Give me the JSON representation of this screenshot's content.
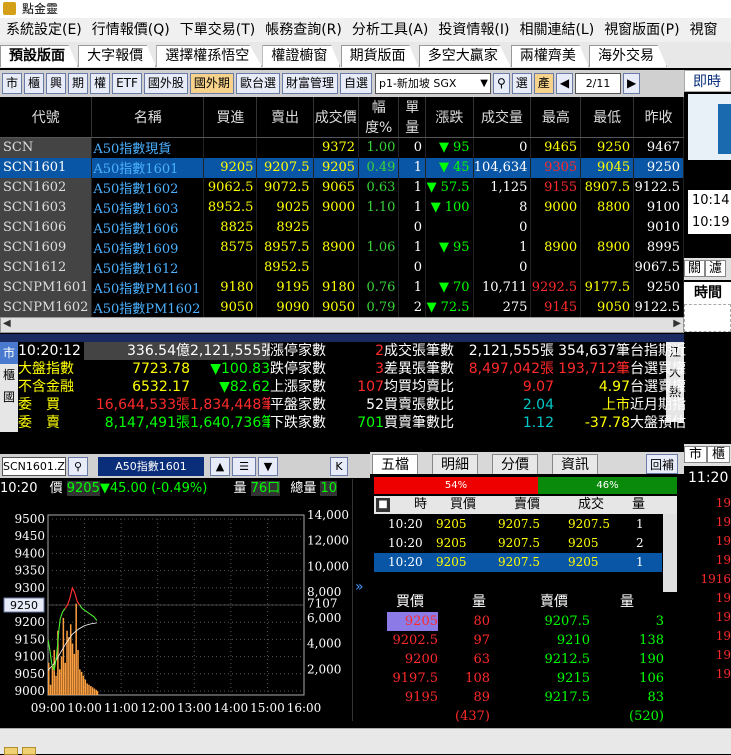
{
  "app_title": "點金靈",
  "menu": [
    "系統設定(E)",
    "行情報價(Q)",
    "下單交易(T)",
    "帳務查詢(R)",
    "分析工具(A)",
    "投資情報(I)",
    "相關連結(L)",
    "視窗版面(P)",
    "視窗"
  ],
  "page_tabs": [
    "預設版面",
    "大字報價",
    "選擇權孫悟空",
    "權證櫥窗",
    "期貨版面",
    "多空大贏家",
    "兩權齊美",
    "海外交易"
  ],
  "toolbar": {
    "buttons": [
      "市",
      "櫃",
      "興",
      "期",
      "權",
      "ETF",
      "國外股",
      "國外期",
      "歐台選",
      "財富管理",
      "自選"
    ],
    "highlight_index": 7,
    "group_select": "p1-新加坡 SGX",
    "search_icon": "search-icon",
    "select_btn": "選",
    "prod_btn": "產",
    "page_indicator": "2/11"
  },
  "right_panel": {
    "title": "即時新",
    "news_times": [
      "10:14",
      "10:19"
    ],
    "tabs": [
      "關",
      "濾"
    ],
    "time_header": "時間",
    "mkt_btns": [
      "市",
      "櫃"
    ],
    "time2": "11:20",
    "nums": [
      "19",
      "19",
      "19",
      "19",
      "1916",
      "19",
      "19",
      "19",
      "19",
      "19"
    ]
  },
  "quote_table": {
    "headers": [
      "代號",
      "名稱",
      "買進",
      "賣出",
      "成交價",
      "幅度%",
      "單量",
      "漲跌",
      "成交量",
      "最高",
      "最低",
      "昨收"
    ],
    "rows": [
      {
        "code": "SCN",
        "name": "A50指數現貨",
        "bid": "",
        "ask": "",
        "last": "9372",
        "pct": "1.00",
        "vol": "0",
        "dir": "up",
        "chg": "95",
        "qty": "0",
        "high": "9465",
        "low": "9250",
        "prev": "9467",
        "high_color": "y",
        "low_color": "y"
      },
      {
        "code": "SCN1601",
        "name": "A50指數1601",
        "bid": "9205",
        "ask": "9207.5",
        "last": "9205",
        "pct": "0.49",
        "vol": "1",
        "dir": "down",
        "chg": "45",
        "qty": "104,634",
        "high": "9305",
        "low": "9045",
        "prev": "9250",
        "high_color": "r",
        "low_color": "y",
        "selected": true
      },
      {
        "code": "SCN1602",
        "name": "A50指數1602",
        "bid": "9062.5",
        "ask": "9072.5",
        "last": "9065",
        "pct": "0.63",
        "vol": "1",
        "dir": "down",
        "chg": "57.5",
        "qty": "1,125",
        "high": "9155",
        "low": "8907.5",
        "prev": "9122.5",
        "high_color": "r",
        "low_color": "y"
      },
      {
        "code": "SCN1603",
        "name": "A50指數1603",
        "bid": "8952.5",
        "ask": "9025",
        "last": "9000",
        "pct": "1.10",
        "vol": "1",
        "dir": "down",
        "chg": "100",
        "qty": "8",
        "high": "9000",
        "low": "8800",
        "prev": "9100",
        "high_color": "y",
        "low_color": "y"
      },
      {
        "code": "SCN1606",
        "name": "A50指數1606",
        "bid": "8825",
        "ask": "8925",
        "last": "",
        "pct": "",
        "vol": "0",
        "dir": "",
        "chg": "",
        "qty": "0",
        "high": "",
        "low": "",
        "prev": "9010"
      },
      {
        "code": "SCN1609",
        "name": "A50指數1609",
        "bid": "8575",
        "ask": "8957.5",
        "last": "8900",
        "pct": "1.06",
        "vol": "1",
        "dir": "down",
        "chg": "95",
        "qty": "1",
        "high": "8900",
        "low": "8900",
        "prev": "8995",
        "high_color": "y",
        "low_color": "y"
      },
      {
        "code": "SCN1612",
        "name": "A50指數1612",
        "bid": "",
        "ask": "8952.5",
        "last": "",
        "pct": "",
        "vol": "0",
        "dir": "",
        "chg": "",
        "qty": "0",
        "high": "",
        "low": "",
        "prev": "9067.5"
      },
      {
        "code": "SCNPM1601",
        "name": "A50指數PM1601",
        "bid": "9180",
        "ask": "9195",
        "last": "9180",
        "pct": "0.76",
        "vol": "1",
        "dir": "down",
        "chg": "70",
        "qty": "10,711",
        "high": "9292.5",
        "low": "9177.5",
        "prev": "9250",
        "high_color": "r",
        "low_color": "y"
      },
      {
        "code": "SCNPM1602",
        "name": "A50指數PM1602",
        "bid": "9050",
        "ask": "9090",
        "last": "9050",
        "pct": "0.79",
        "vol": "2",
        "dir": "down",
        "chg": "72.5",
        "qty": "275",
        "high": "9145",
        "low": "9050",
        "prev": "9122.5",
        "high_color": "r",
        "low_color": "y"
      }
    ]
  },
  "summary": {
    "side_left": [
      "市",
      "櫃",
      "國"
    ],
    "side_right": [
      "江",
      "大",
      "熱"
    ],
    "time": "10:20:12",
    "amount": "336.54億",
    "volume_zhang": "2,121,555張",
    "rows": [
      [
        "10:20:12",
        "336.54億",
        "2,121,555張",
        "漲停家數",
        "2",
        "成交張筆數",
        "2,121,555張",
        "354,637筆",
        "台指期近"
      ],
      [
        "大盤指數",
        "7723.78",
        "▼100.83",
        "跌停家數",
        "3",
        "差異張筆數",
        "8,497,042張",
        "193,712筆",
        "台選買權"
      ],
      [
        "不含金融",
        "6532.17",
        "▼82.62",
        "上漲家數",
        "107",
        "均買均賣比",
        "9.07",
        "4.97",
        "台選賣權"
      ],
      [
        "委　買",
        "16,644,533張",
        "1,834,448筆",
        "平盤家數",
        "52",
        "買賣張數比",
        "2.04",
        "上市",
        "近月期指"
      ],
      [
        "委　賣",
        "8,147,491張",
        "1,640,736筆",
        "下跌家數",
        "701",
        "買賣筆數比",
        "1.12",
        "-37.78",
        "大盤預估"
      ]
    ]
  },
  "mini_quote": {
    "combo": "SCN1601.Z",
    "name": "A50指數1601",
    "k_btn": "K",
    "time": "10:20",
    "price_label": "價",
    "price": "9205",
    "change": "▼45.00 (-0.49%)",
    "vol_label": "量",
    "vol": "76口",
    "total_label": "總量",
    "total": "10"
  },
  "chart_data": {
    "type": "line",
    "x_ticks": [
      "09:00",
      "10:00",
      "11:00",
      "12:00",
      "13:00",
      "14:00",
      "15:00",
      "16:00"
    ],
    "y_ticks_left": [
      "9500",
      "9450",
      "9400",
      "9350",
      "9300",
      "9250",
      "9200",
      "9150",
      "9100",
      "9050",
      "9000"
    ],
    "y_ticks_right": [
      "14,000",
      "12,000",
      "10,000",
      "8,000",
      "7107",
      "6,000",
      "4,000",
      "2,000"
    ],
    "ylim": [
      9000,
      9500
    ],
    "ylim_right": [
      0,
      14000
    ],
    "ref_price": "9250",
    "series": [
      {
        "x": [
          0,
          3,
          6,
          10,
          14,
          18,
          20,
          24,
          28,
          32,
          36,
          40,
          44,
          48,
          52,
          56,
          60,
          64,
          68,
          72,
          76,
          80
        ],
        "values": [
          9150,
          9120,
          9080,
          9060,
          9100,
          9180,
          9210,
          9230,
          9240,
          9250,
          9270,
          9300,
          9285,
          9260,
          9250,
          9240,
          9235,
          9230,
          9225,
          9220,
          9215,
          9205
        ]
      },
      {
        "x": [
          0,
          10,
          20,
          30,
          40,
          50,
          60,
          70,
          80
        ],
        "values": [
          9060,
          9080,
          9110,
          9140,
          9165,
          9180,
          9190,
          9195,
          9198
        ]
      }
    ],
    "volume_x": [
      0,
      3,
      6,
      9,
      12,
      15,
      18,
      21,
      24,
      27,
      30,
      33,
      36,
      39,
      42,
      45,
      48,
      51,
      54,
      57,
      60,
      63,
      66,
      69,
      72,
      75,
      78,
      80
    ],
    "volume": [
      2500,
      800,
      2200,
      3500,
      1500,
      5000,
      2000,
      3000,
      6000,
      2500,
      5000,
      4500,
      5500,
      4000,
      3200,
      7107,
      3500,
      2000,
      1800,
      1500,
      1200,
      900,
      800,
      700,
      600,
      500,
      400,
      300
    ]
  },
  "order_panel": {
    "tabs": [
      "五檔",
      "明細",
      "分價",
      "資訊"
    ],
    "return_btn": "回補",
    "ratio_red": "54%",
    "ratio_green": "46%",
    "tick_headers": [
      "時",
      "買價",
      "賣價",
      "成交",
      "量"
    ],
    "ticks": [
      {
        "time": "10:20",
        "bid": "9205",
        "ask": "9207.5",
        "last": "9207.5",
        "qty": "1"
      },
      {
        "time": "10:20",
        "bid": "9205",
        "ask": "9207.5",
        "last": "9205",
        "qty": "2"
      },
      {
        "time": "10:20",
        "bid": "9205",
        "ask": "9207.5",
        "last": "9205",
        "qty": "1",
        "selected": true
      }
    ],
    "book_headers": [
      "買價",
      "量",
      "賣價",
      "量"
    ],
    "book": [
      {
        "bid": "9205",
        "bid_qty": "80",
        "ask": "9207.5",
        "ask_qty": "3"
      },
      {
        "bid": "9202.5",
        "bid_qty": "97",
        "ask": "9210",
        "ask_qty": "138"
      },
      {
        "bid": "9200",
        "bid_qty": "63",
        "ask": "9212.5",
        "ask_qty": "190"
      },
      {
        "bid": "9197.5",
        "bid_qty": "108",
        "ask": "9215",
        "ask_qty": "106"
      },
      {
        "bid": "9195",
        "bid_qty": "89",
        "ask": "9217.5",
        "ask_qty": "83"
      }
    ],
    "bid_total": "(437)",
    "ask_total": "(520)"
  },
  "colors": {
    "accent_blue": "#0a56a6",
    "up_red": "#ff2a2a",
    "down_green": "#00ff00",
    "price_yellow": "#ffff00"
  }
}
